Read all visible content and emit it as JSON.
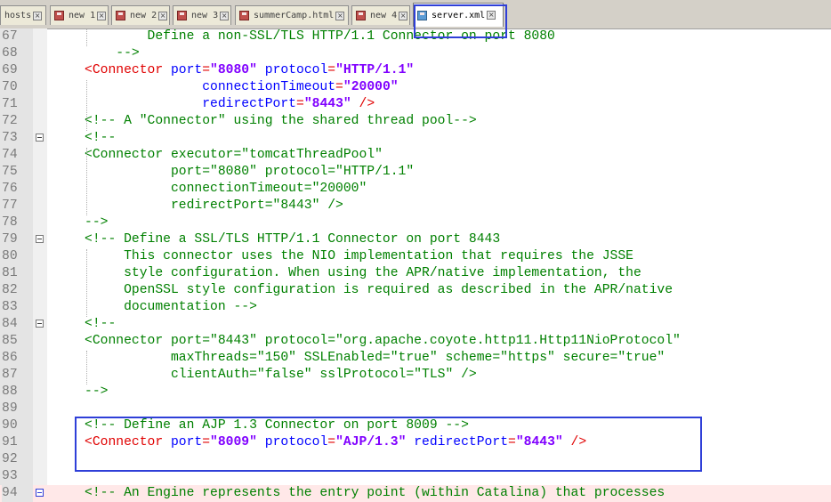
{
  "tabs": [
    {
      "label": "hosts",
      "active": false
    },
    {
      "label": "new 1",
      "active": false
    },
    {
      "label": "new 2",
      "active": false
    },
    {
      "label": "new 3",
      "active": false
    },
    {
      "label": "summerCamp.html",
      "active": false
    },
    {
      "label": "new 4",
      "active": false
    },
    {
      "label": "server.xml",
      "active": true
    }
  ],
  "colors": {
    "comment": "#008000",
    "tag": "#e00000",
    "attribute": "#0000ff",
    "value": "#8000ff",
    "annotation": "#2f3fd8"
  },
  "lines": [
    {
      "n": "67",
      "segs": [
        [
          "cm",
          "        Define a non-SSL/TLS HTTP/1.1 Connector on port 8080"
        ]
      ]
    },
    {
      "n": "68",
      "segs": [
        [
          "cm",
          "    -->"
        ]
      ]
    },
    {
      "n": "69",
      "segs": [
        [
          "tag",
          "<Connector"
        ],
        [
          "at",
          " port"
        ],
        [
          "tag",
          "="
        ],
        [
          "val",
          "\"8080\""
        ],
        [
          "at",
          " protocol"
        ],
        [
          "tag",
          "="
        ],
        [
          "val",
          "\"HTTP/1.1\""
        ]
      ]
    },
    {
      "n": "70",
      "segs": [
        [
          "at",
          "               connectionTimeout"
        ],
        [
          "tag",
          "="
        ],
        [
          "val",
          "\"20000\""
        ]
      ]
    },
    {
      "n": "71",
      "segs": [
        [
          "at",
          "               redirectPort"
        ],
        [
          "tag",
          "="
        ],
        [
          "val",
          "\"8443\""
        ],
        [
          "tag",
          " />"
        ]
      ]
    },
    {
      "n": "72",
      "segs": [
        [
          "cm",
          "<!-- A \"Connector\" using the shared thread pool-->"
        ]
      ]
    },
    {
      "n": "73",
      "fold": true,
      "segs": [
        [
          "cm",
          "<!--"
        ]
      ]
    },
    {
      "n": "74",
      "segs": [
        [
          "cm",
          "<Connector executor=\"tomcatThreadPool\""
        ]
      ]
    },
    {
      "n": "75",
      "segs": [
        [
          "cm",
          "           port=\"8080\" protocol=\"HTTP/1.1\""
        ]
      ]
    },
    {
      "n": "76",
      "segs": [
        [
          "cm",
          "           connectionTimeout=\"20000\""
        ]
      ]
    },
    {
      "n": "77",
      "segs": [
        [
          "cm",
          "           redirectPort=\"8443\" />"
        ]
      ]
    },
    {
      "n": "78",
      "segs": [
        [
          "cm",
          "-->"
        ]
      ]
    },
    {
      "n": "79",
      "fold": true,
      "segs": [
        [
          "cm",
          "<!-- Define a SSL/TLS HTTP/1.1 Connector on port 8443"
        ]
      ]
    },
    {
      "n": "80",
      "segs": [
        [
          "cm",
          "     This connector uses the NIO implementation that requires the JSSE"
        ]
      ]
    },
    {
      "n": "81",
      "segs": [
        [
          "cm",
          "     style configuration. When using the APR/native implementation, the"
        ]
      ]
    },
    {
      "n": "82",
      "segs": [
        [
          "cm",
          "     OpenSSL style configuration is required as described in the APR/native"
        ]
      ]
    },
    {
      "n": "83",
      "segs": [
        [
          "cm",
          "     documentation -->"
        ]
      ]
    },
    {
      "n": "84",
      "fold": true,
      "segs": [
        [
          "cm",
          "<!--"
        ]
      ]
    },
    {
      "n": "85",
      "segs": [
        [
          "cm",
          "<Connector port=\"8443\" protocol=\"org.apache.coyote.http11.Http11NioProtocol\""
        ]
      ]
    },
    {
      "n": "86",
      "segs": [
        [
          "cm",
          "           maxThreads=\"150\" SSLEnabled=\"true\" scheme=\"https\" secure=\"true\""
        ]
      ]
    },
    {
      "n": "87",
      "segs": [
        [
          "cm",
          "           clientAuth=\"false\" sslProtocol=\"TLS\" />"
        ]
      ]
    },
    {
      "n": "88",
      "segs": [
        [
          "cm",
          "-->"
        ]
      ]
    },
    {
      "n": "89",
      "segs": []
    },
    {
      "n": "90",
      "segs": [
        [
          "cm",
          "<!-- Define an AJP 1.3 Connector on port 8009 -->"
        ]
      ]
    },
    {
      "n": "91",
      "segs": [
        [
          "tag",
          "<Connector"
        ],
        [
          "at",
          " port"
        ],
        [
          "tag",
          "="
        ],
        [
          "val",
          "\"8009\""
        ],
        [
          "at",
          " protocol"
        ],
        [
          "tag",
          "="
        ],
        [
          "val",
          "\"AJP/1.3\""
        ],
        [
          "at",
          " redirectPort"
        ],
        [
          "tag",
          "="
        ],
        [
          "val",
          "\"8443\""
        ],
        [
          "tag",
          " />"
        ]
      ]
    },
    {
      "n": "92",
      "segs": []
    },
    {
      "n": "93",
      "segs": []
    },
    {
      "n": "94",
      "fold": true,
      "hl": true,
      "segs": [
        [
          "cm",
          "<!-- An Engine represents the entry point (within Catalina) that processes"
        ]
      ]
    }
  ]
}
